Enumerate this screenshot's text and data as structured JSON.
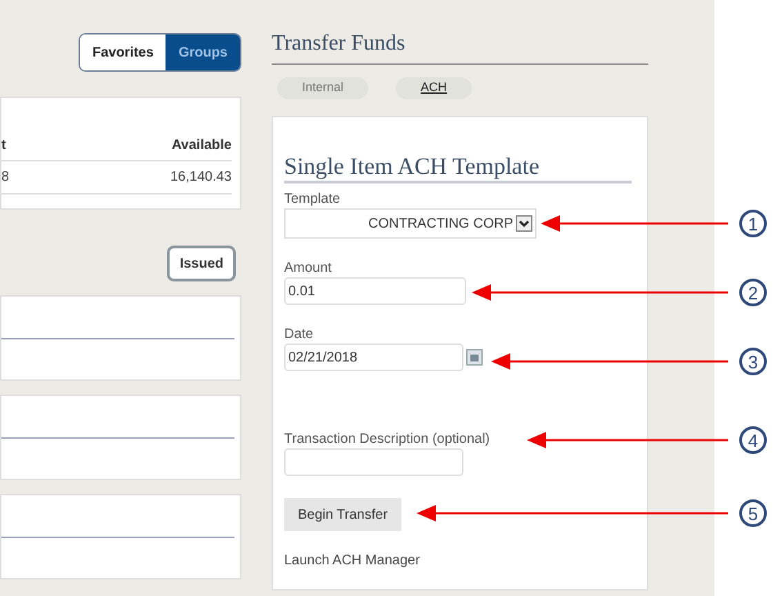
{
  "accounts": {
    "toggle": [
      {
        "label": "Favorites",
        "selected": false
      },
      {
        "label": "Groups",
        "selected": true
      }
    ],
    "columns": [
      "t",
      "Available"
    ],
    "rows": [
      [
        "8",
        "16,140.43"
      ]
    ]
  },
  "issued_button": "Issued",
  "panels": [
    {
      "kind": "blank"
    },
    {
      "kind": "blank"
    },
    {
      "kind": "blank"
    }
  ],
  "transfer": {
    "title": "Transfer Funds",
    "tabs": [
      {
        "label": "Internal",
        "selected": false
      },
      {
        "label": "ACH",
        "selected": true
      }
    ],
    "heading": "Single Item ACH Template",
    "template": {
      "label": "Template",
      "value": "CONTRACTING CORP"
    },
    "amount": {
      "label": "Amount",
      "value": "0.01"
    },
    "date": {
      "label": "Date",
      "value": "02/21/2018"
    },
    "description": {
      "label": "Transaction Description (optional)"
    },
    "button": "Begin Transfer",
    "link": "Launch ACH Manager"
  },
  "callouts": [
    {
      "number": "1"
    },
    {
      "number": "2"
    },
    {
      "number": "3"
    },
    {
      "number": "4"
    },
    {
      "number": "5"
    }
  ]
}
